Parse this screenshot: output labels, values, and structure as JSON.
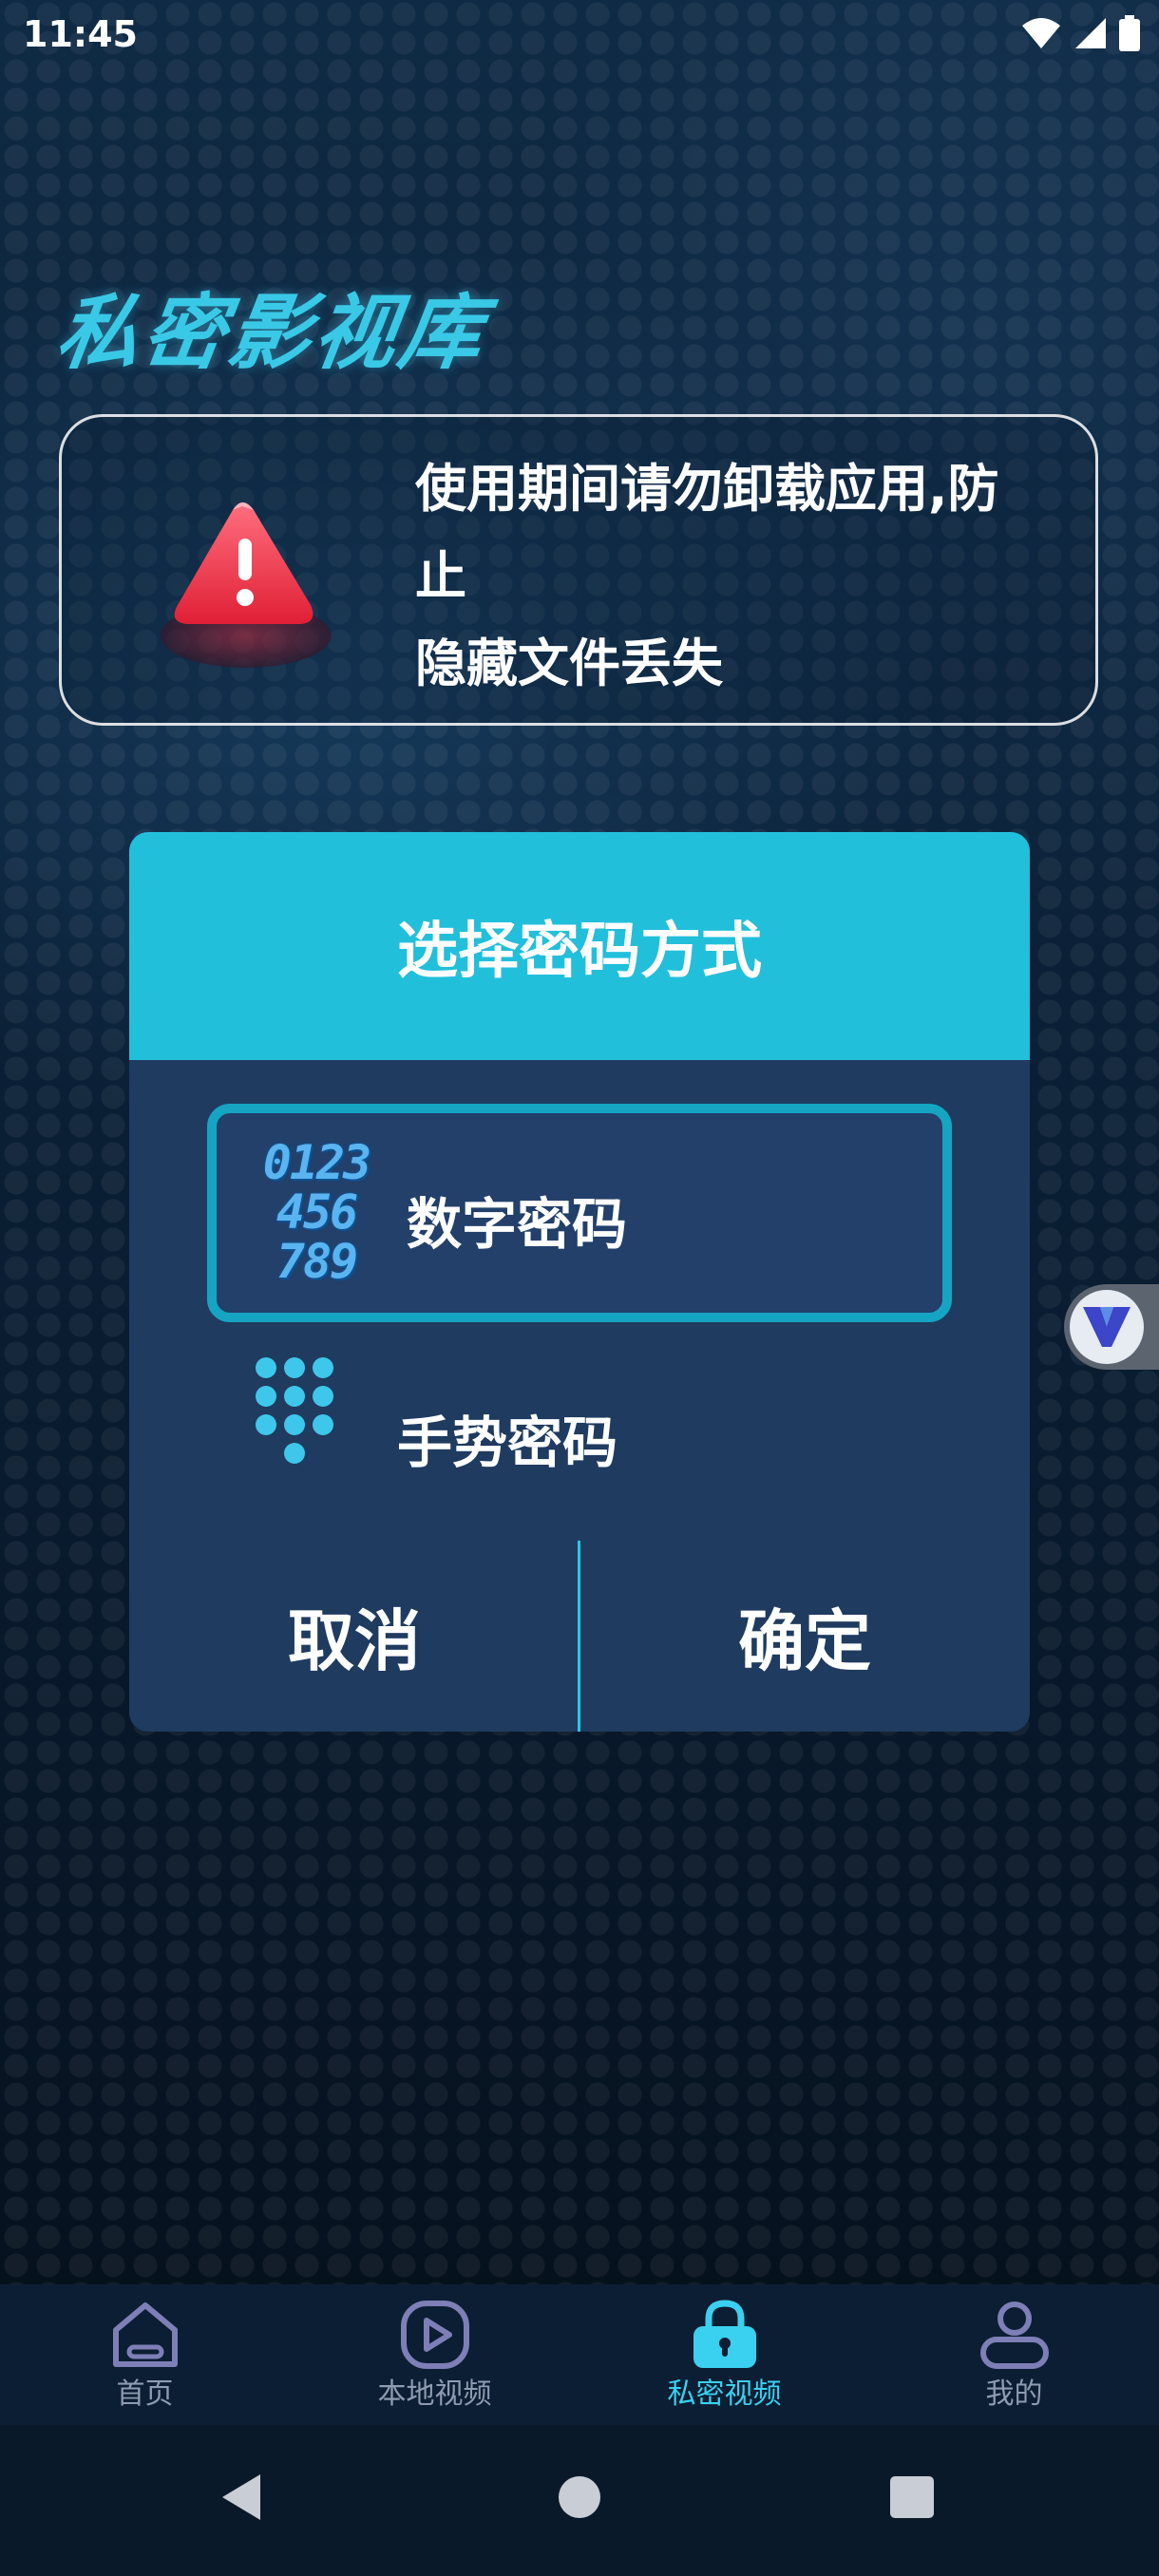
{
  "status_bar": {
    "time": "11:45"
  },
  "app_title": "私密影视库",
  "warning": {
    "text": "使用期间请勿卸载应用,防\n止\n隐藏文件丢失"
  },
  "dialog": {
    "title": "选择密码方式",
    "options": [
      {
        "label": "数字密码",
        "selected": true,
        "icon_text": [
          "0123",
          "456",
          "789"
        ]
      },
      {
        "label": "手势密码",
        "selected": false
      }
    ],
    "cancel_label": "取消",
    "confirm_label": "确定"
  },
  "bottom_nav": {
    "items": [
      {
        "label": "首页",
        "icon": "home-icon",
        "active": false
      },
      {
        "label": "本地视频",
        "icon": "play-icon",
        "active": false
      },
      {
        "label": "私密视频",
        "icon": "lock-icon",
        "active": true
      },
      {
        "label": "我的",
        "icon": "user-icon",
        "active": false
      }
    ]
  },
  "colors": {
    "accent": "#22bfdb",
    "title": "#39c9e6",
    "dialog_body": "#1f3b60",
    "nav_active": "#3ad0f0",
    "nav_inactive": "#8e9bb0"
  }
}
